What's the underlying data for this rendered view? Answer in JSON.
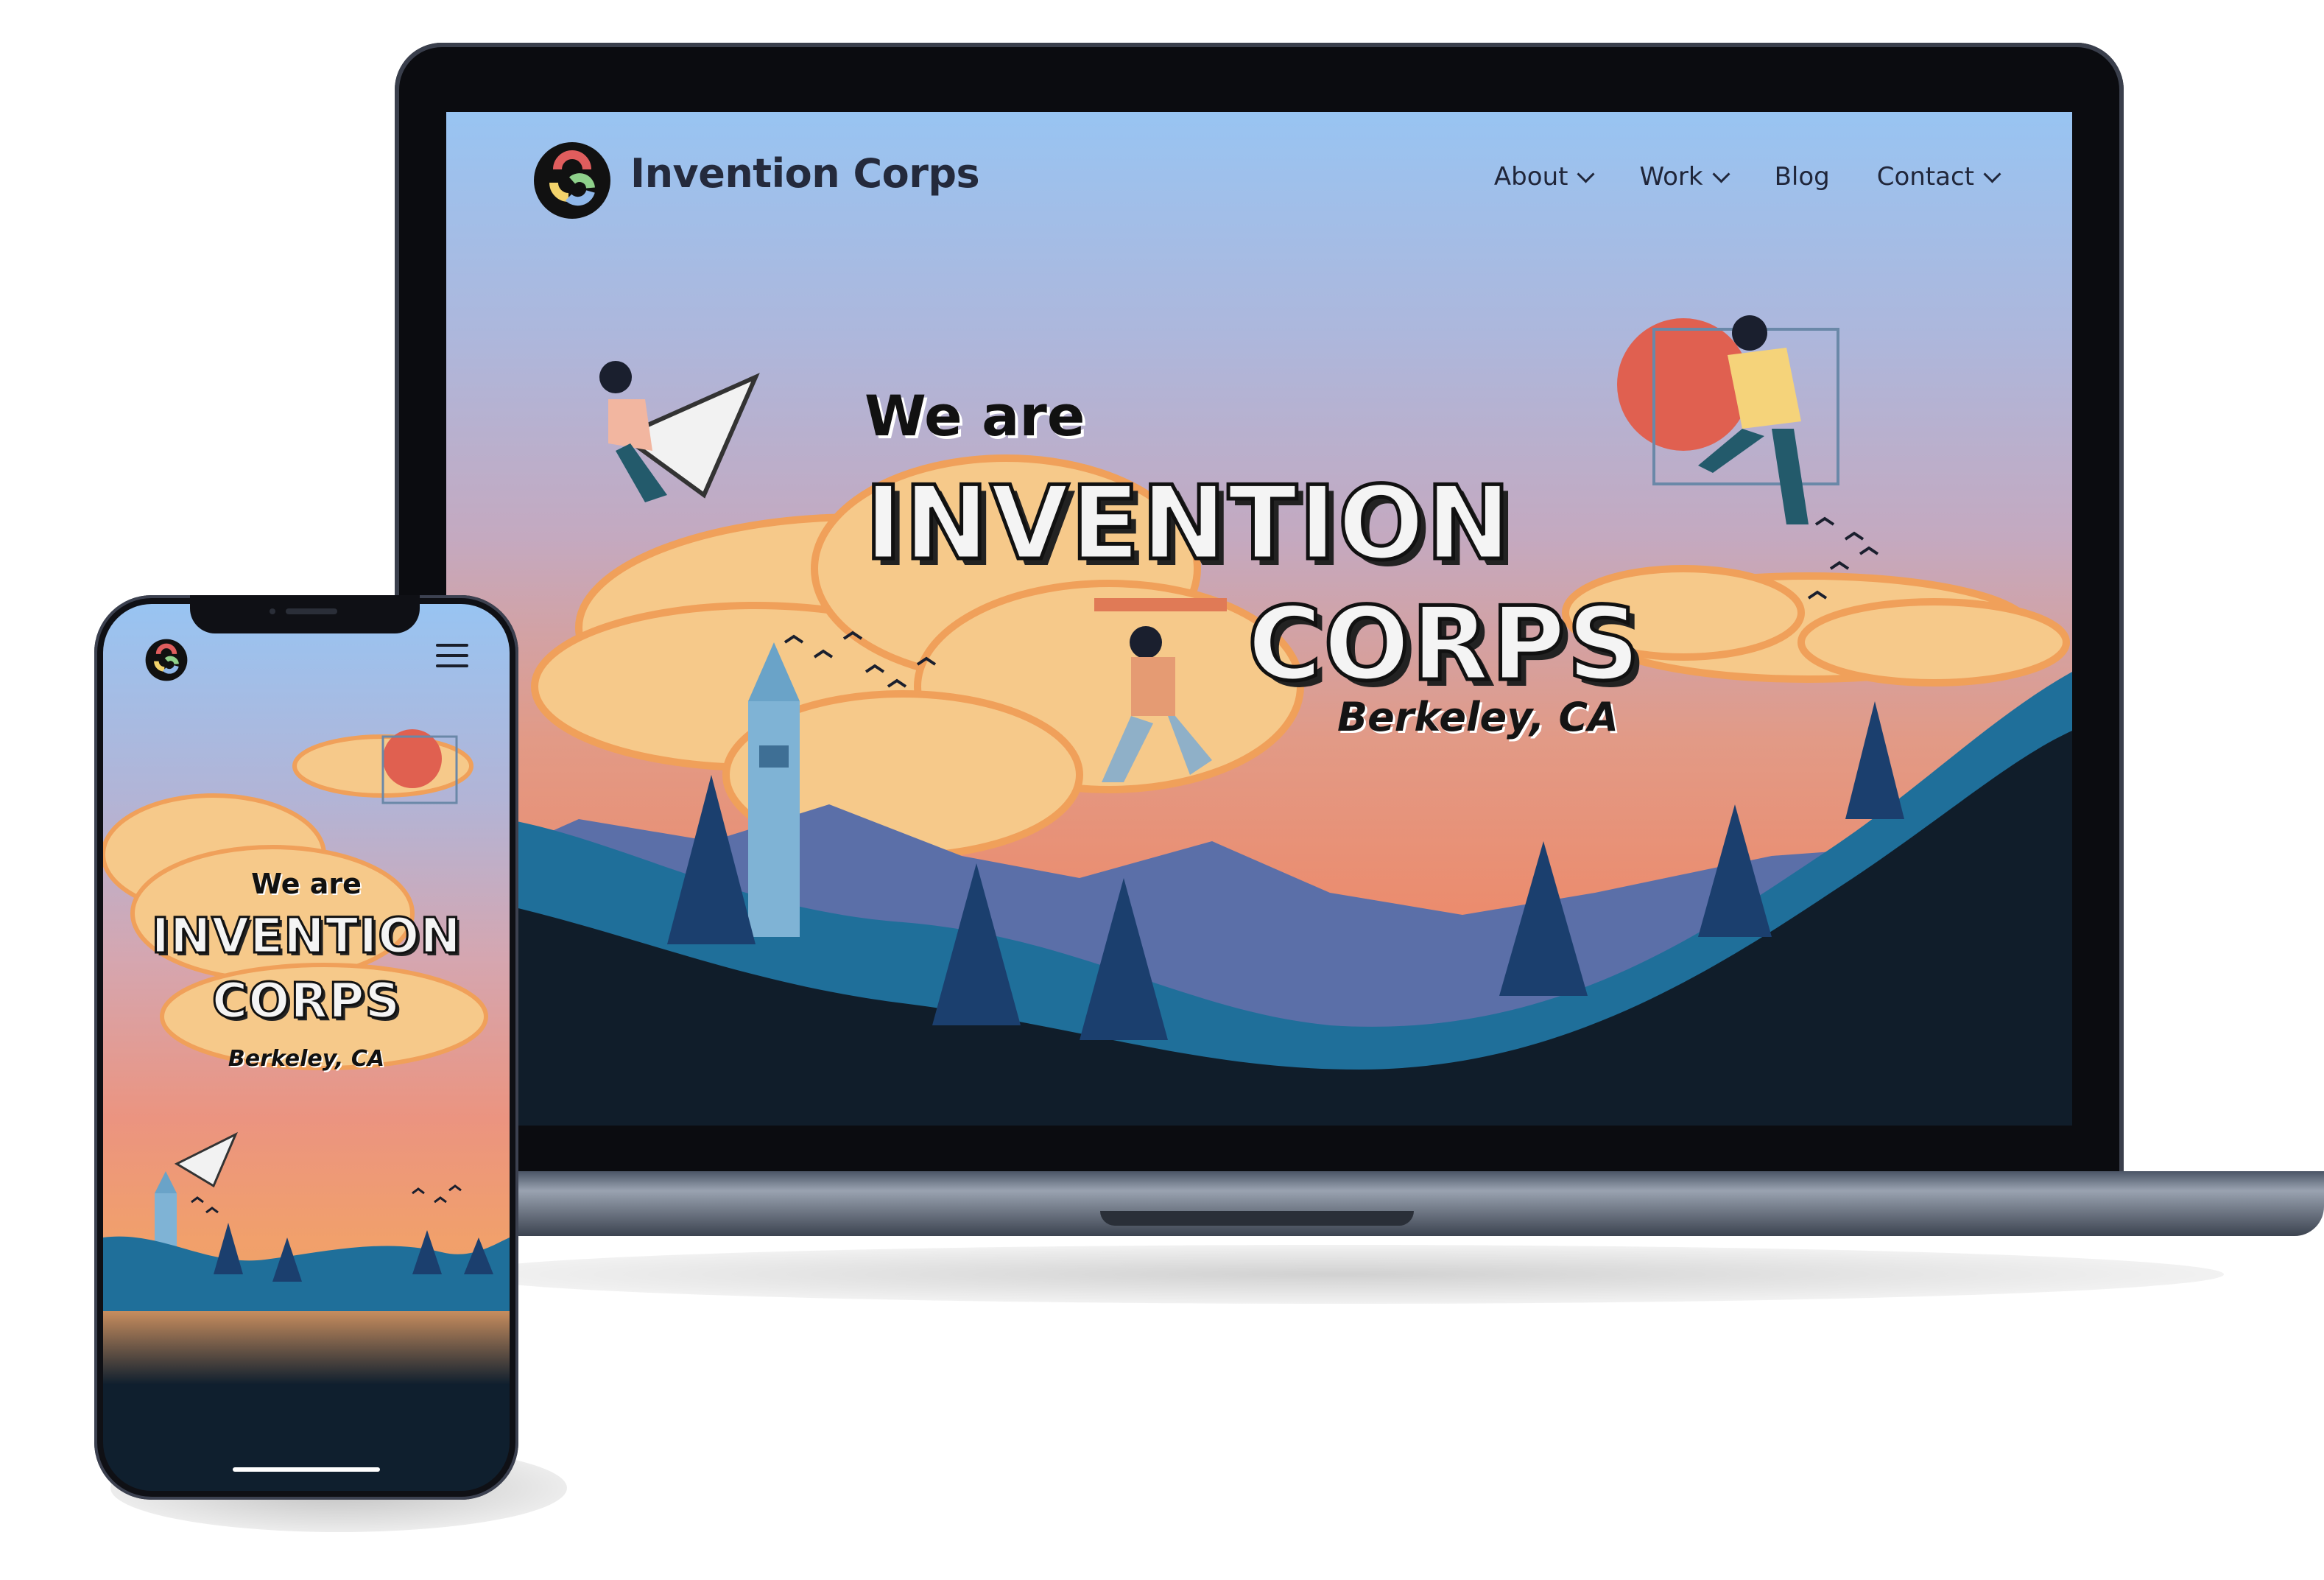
{
  "laptop": {
    "brand": {
      "name": "Invention Corps"
    },
    "nav": {
      "items": [
        {
          "label": "About",
          "has_dropdown": true
        },
        {
          "label": "Work",
          "has_dropdown": true
        },
        {
          "label": "Blog",
          "has_dropdown": false
        },
        {
          "label": "Contact",
          "has_dropdown": true
        }
      ]
    },
    "hero": {
      "we_are": "We are",
      "line1": "INVENTION",
      "line2": "CORPS",
      "location": "Berkeley, CA"
    }
  },
  "phone": {
    "hero": {
      "we_are": "We are",
      "line1": "INVENTION",
      "line2": "CORPS",
      "location": "Berkeley, CA"
    }
  },
  "icons": [
    "logo-icon",
    "chevron-down-icon",
    "hamburger-menu-icon"
  ],
  "colors": {
    "sky_top": "#98c4f2",
    "sky_bottom": "#e6855e",
    "ground_dark": "#0f1f2e",
    "hill_blue": "#1f6f9a",
    "accent_red": "#e05d5d",
    "accent_yellow": "#f3d36b",
    "accent_green": "#8fd18b",
    "accent_blue": "#8fb7e9"
  }
}
